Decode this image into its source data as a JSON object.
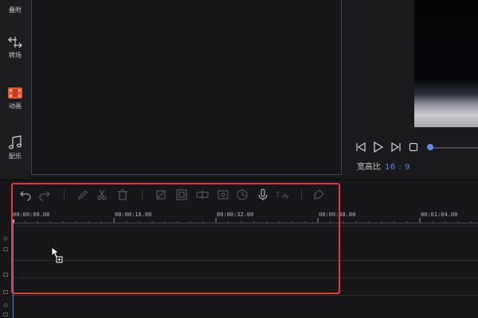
{
  "sidebar": {
    "items": [
      {
        "label": "叠附",
        "icon": "overlay-icon"
      },
      {
        "label": "转场",
        "icon": "transition-icon"
      },
      {
        "label": "动画",
        "icon": "animation-icon"
      },
      {
        "label": "配乐",
        "icon": "music-icon"
      }
    ]
  },
  "player": {
    "aspect_label": "宽高比",
    "aspect_value": "16 : 9",
    "controls": [
      "rewind-icon",
      "play-icon",
      "forward-icon",
      "stop-icon"
    ],
    "progress": 0.0
  },
  "toolbar": {
    "icons": [
      "undo-icon",
      "redo-icon",
      "pen-icon",
      "scissors-icon",
      "trash-icon",
      "crop-icon",
      "zoom-icon",
      "split-icon",
      "screen-icon",
      "clock-icon",
      "mic-icon",
      "text-speech-icon",
      "mark-icon"
    ]
  },
  "ruler": {
    "ticks": [
      "00:00:00.00",
      "00:00:16.00",
      "00:00:32.00",
      "00:00:48.00",
      "00:01:04.00"
    ]
  },
  "colors": {
    "accent": "#5b8fe6",
    "highlight": "#e23b3b"
  }
}
